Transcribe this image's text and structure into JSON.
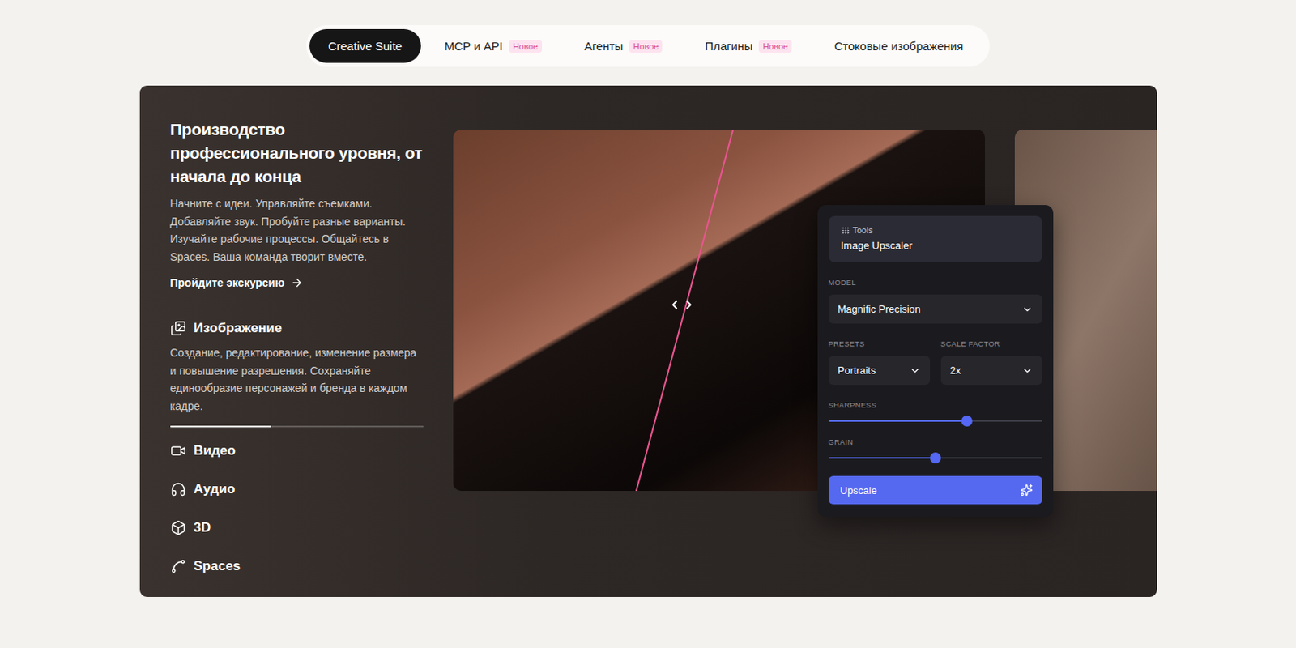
{
  "nav": {
    "tabs": [
      {
        "label": "Creative Suite",
        "selected": true
      },
      {
        "label": "MCP и API",
        "selected": false,
        "badge": "Новое"
      },
      {
        "label": "Агенты",
        "selected": false,
        "badge": "Новое"
      },
      {
        "label": "Плагины",
        "selected": false,
        "badge": "Новое"
      },
      {
        "label": "Стоковые изображения",
        "selected": false
      }
    ]
  },
  "hero": {
    "title": "Производство профессионального уровня, от начала до конца",
    "description": "Начните с идеи. Управляйте съемками. Добавляйте звук. Пробуйте разные варианты. Изучайте рабочие процессы. Общайтесь в Spaces. Ваша команда творит вместе.",
    "tour_link": "Пройдите экскурсию"
  },
  "categories": [
    {
      "label": "Изображение",
      "expanded": true,
      "description": "Создание, редактирование, изменение размера и повышение разрешения. Сохраняйте единообразие персонажей и бренда в каждом кадре.",
      "level": 0.4
    },
    {
      "label": "Видео",
      "expanded": false
    },
    {
      "label": "Аудио",
      "expanded": false
    },
    {
      "label": "3D",
      "expanded": false
    },
    {
      "label": "Spaces",
      "expanded": false
    }
  ],
  "compare": {
    "level": 0.43
  },
  "tools_panel": {
    "eyebrow": "Tools",
    "title": "Image Upscaler",
    "model": {
      "label": "MODEL",
      "value": "Magnific Precision"
    },
    "presets": {
      "label": "PRESETS",
      "value": "Portraits"
    },
    "scale_factor": {
      "label": "SCALE FACTOR",
      "value": "2x"
    },
    "sliders": [
      {
        "label": "SHARPNESS",
        "level": 0.65
      },
      {
        "label": "GRAIN",
        "level": 0.5
      }
    ],
    "button": "Upscale"
  }
}
